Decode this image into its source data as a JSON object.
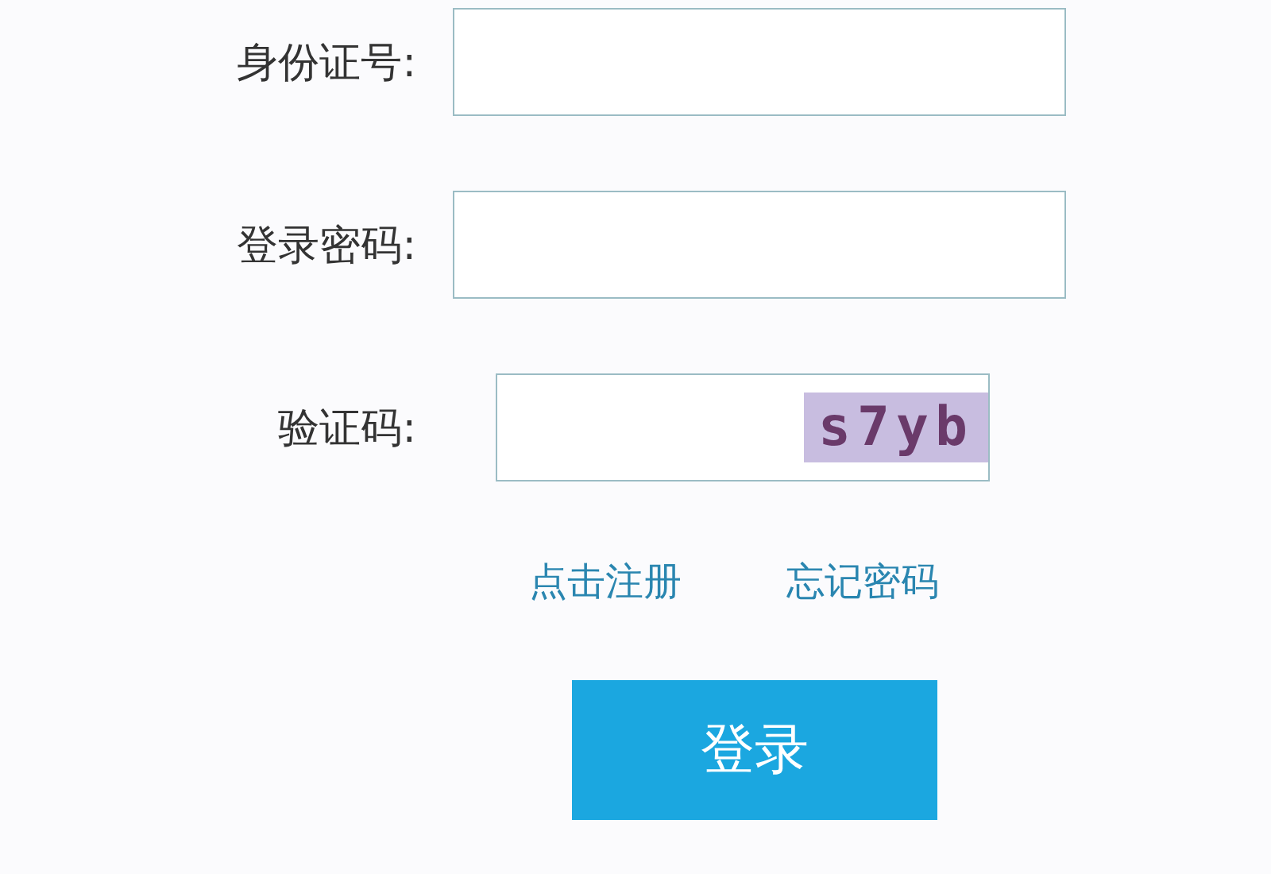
{
  "fields": [
    {
      "label": "身份证号:",
      "kind": "text"
    },
    {
      "label": "登录密码:",
      "kind": "text"
    },
    {
      "label": "验证码:",
      "kind": "captcha",
      "captcha": "s7yb"
    }
  ],
  "links": [
    "点击注册",
    "忘记密码"
  ],
  "button": "登录"
}
